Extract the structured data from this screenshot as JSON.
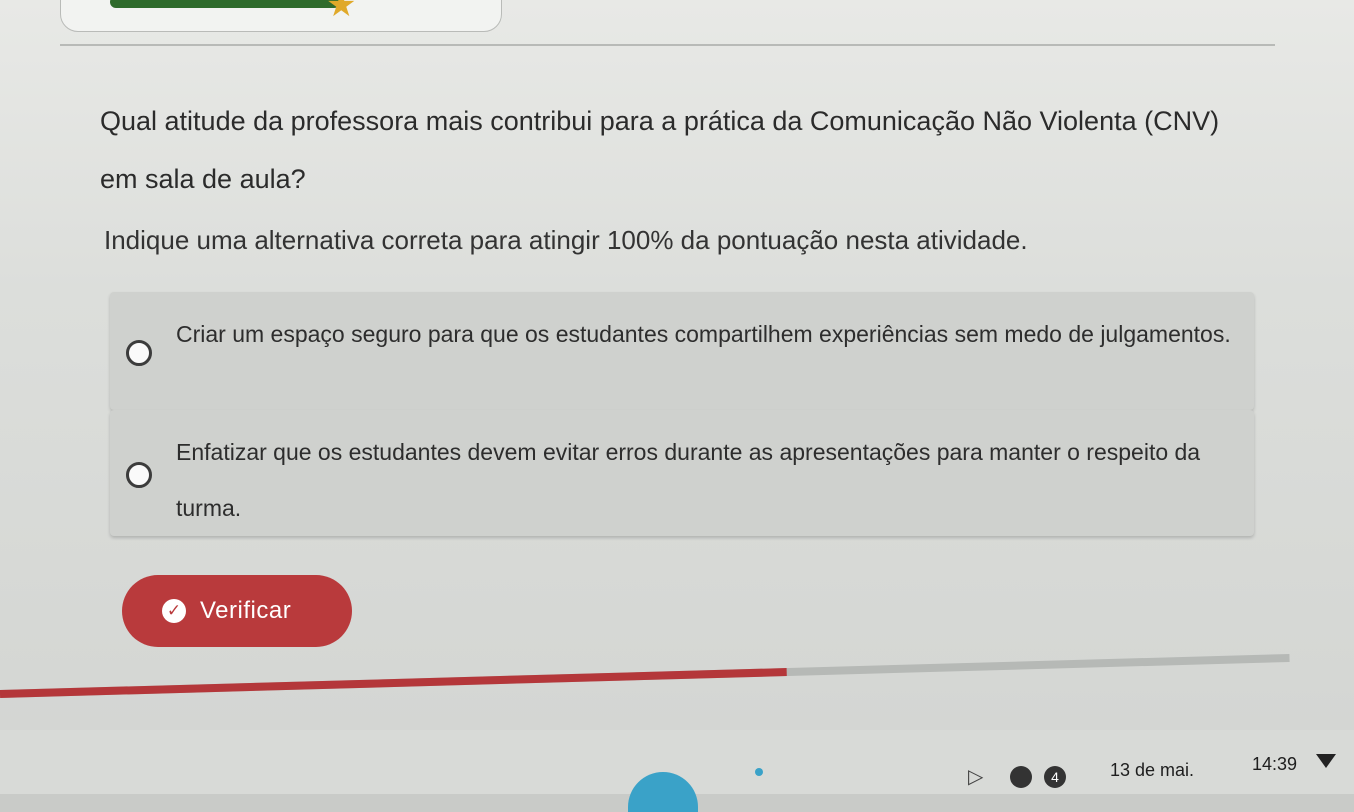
{
  "question": {
    "text": "Qual atitude da professora mais contribui para a prática da Comunicação Não Violenta (CNV) em sala de aula?"
  },
  "instruction": "Indique uma alternativa correta para atingir 100% da pontuação nesta atividade.",
  "options": [
    {
      "label": "Criar um espaço seguro para que os estudantes compartilhem experiências sem medo de julgamentos.",
      "selected": false
    },
    {
      "label": "Enfatizar que os estudantes devem evitar erros durante as apresentações para manter o respeito da turma.",
      "selected": false
    }
  ],
  "verify_button": {
    "label": "Verificar",
    "icon": "check-circle-icon",
    "color": "#b93a3c"
  },
  "progress": {
    "fraction": 0.61,
    "color": "#b4373a"
  },
  "taskbar": {
    "date": "13 de mai.",
    "time": "14:39",
    "notification_count": "4",
    "icons": [
      "play-icon",
      "circle-icon",
      "notification-badge-icon",
      "wifi-icon"
    ]
  }
}
